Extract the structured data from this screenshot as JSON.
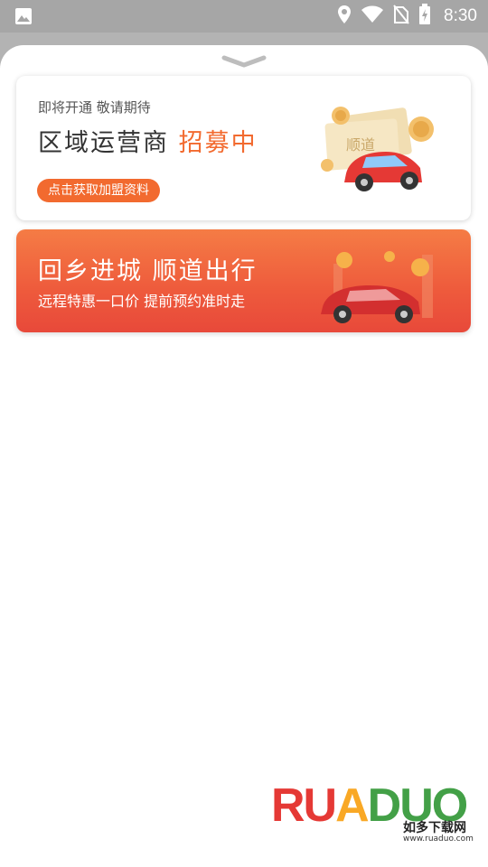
{
  "status_bar": {
    "time": "8:30",
    "icons": [
      "image-icon",
      "location-icon",
      "wifi-icon",
      "no-sim-icon",
      "battery-charging-icon"
    ]
  },
  "sheet": {
    "handle_icon": "chevron-down-icon"
  },
  "recruit_card": {
    "subtitle": "即将开通 敬请期待",
    "title_main": "区域运营商",
    "title_accent": "招募中",
    "cta_label": "点击获取加盟资料",
    "ticket_label": "顺道",
    "illustration": "car-ticket-coins-illustration"
  },
  "banner_card": {
    "headline": "回乡进城 顺道出行",
    "tagline": "远程特惠一口价 提前预约准时走",
    "illustration": "red-car-coins-illustration"
  },
  "watermark": {
    "brand_r": "RU",
    "brand_u": "A",
    "brand_a": "DUO",
    "cn": "如多下载网",
    "url": "www.ruaduo.com"
  },
  "colors": {
    "accent": "#f26a2f",
    "banner_start": "#f57c45",
    "banner_end": "#e8493a",
    "status_bar": "#a6a6a6",
    "scrim": "#b3b3b3"
  }
}
